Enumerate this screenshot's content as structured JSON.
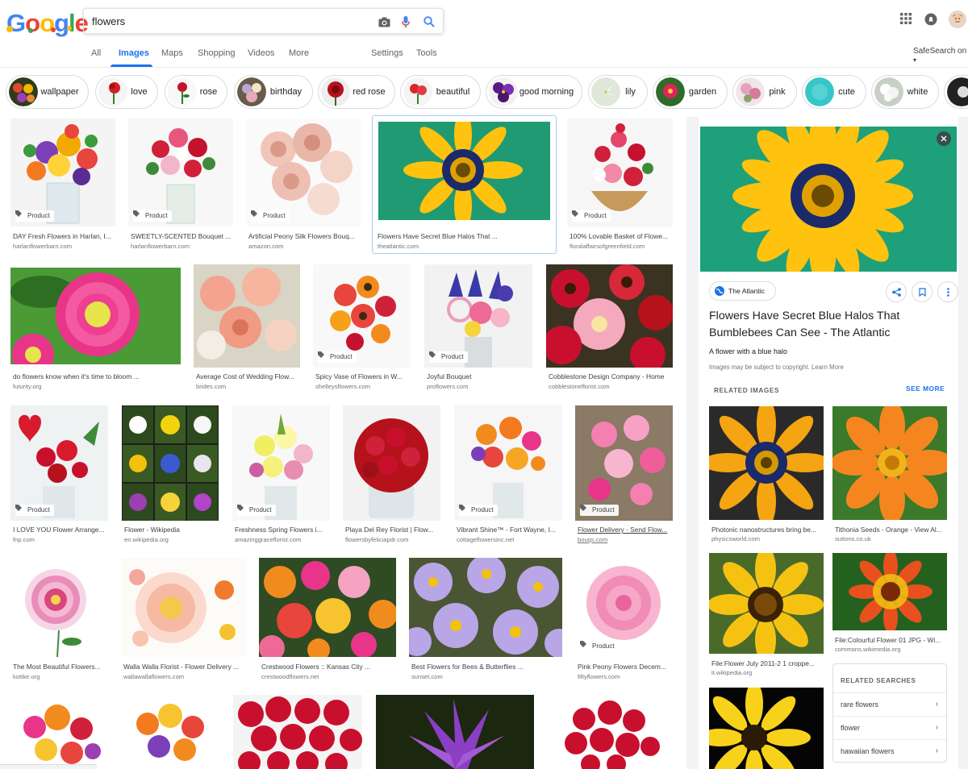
{
  "header": {
    "logo_letters": [
      "G",
      "o",
      "o",
      "g",
      "l",
      "e"
    ],
    "logo_colors": [
      "#4285f4",
      "#ea4335",
      "#fbbc05",
      "#4285f4",
      "#34a853",
      "#ea4335"
    ],
    "search_query": "flowers",
    "tabs": [
      {
        "label": "All",
        "active": false
      },
      {
        "label": "Images",
        "active": true
      },
      {
        "label": "Maps",
        "active": false
      },
      {
        "label": "Shopping",
        "active": false
      },
      {
        "label": "Videos",
        "active": false
      },
      {
        "label": "More",
        "active": false
      }
    ],
    "settings_label": "Settings",
    "tools_label": "Tools",
    "safesearch_label": "SafeSearch on",
    "accent_color": "#1a73e8"
  },
  "chips": [
    "wallpaper",
    "love",
    "rose",
    "birthday",
    "red rose",
    "beautiful",
    "good morning",
    "lily",
    "garden",
    "pink",
    "cute",
    "white"
  ],
  "product_label": "Product",
  "results": [
    {
      "title": "DAY Fresh Flowers in Harlan, I...",
      "source": "harlanflowerbarn.com"
    },
    {
      "title": "SWEETLY-SCENTED Bouquet ...",
      "source": "harlanflowerbarn.com"
    },
    {
      "title": "Artificial Peony Silk Flowers Bouq...",
      "source": "amazon.com"
    },
    {
      "title": "Flowers Have Secret Blue Halos That ...",
      "source": "theatlantic.com"
    },
    {
      "title": "100% Lovable Basket of Flowe...",
      "source": "floralaffairsofgreenfield.com"
    },
    {
      "title": "do flowers know when it's time to bloom ...",
      "source": "futurity.org"
    },
    {
      "title": "Average Cost of Wedding Flow...",
      "source": "brides.com"
    },
    {
      "title": "Spicy Vase of Flowers in W...",
      "source": "shelleysflowers.com"
    },
    {
      "title": "Joyful Bouquet",
      "source": "proflowers.com"
    },
    {
      "title": "Cobblestone Design Company - Home",
      "source": "cobblestoneflorist.com"
    },
    {
      "title": "I LOVE YOU Flower Arrange...",
      "source": "fnp.com"
    },
    {
      "title": "Flower - Wikipedia",
      "source": "en.wikipedia.org"
    },
    {
      "title": "Freshness Spring Flowers i...",
      "source": "amazinggraceflorist.com"
    },
    {
      "title": "Playa Del Rey Florist | Flow...",
      "source": "flowersbyfeliciapdr.com"
    },
    {
      "title": "Vibrant Shine™ - Fort Wayne, I...",
      "source": "cottageflowersinc.net"
    },
    {
      "title": "Flower Delivery - Send Flow...",
      "source": "bouqs.com"
    },
    {
      "title": "The Most Beautiful Flowers...",
      "source": "kottke.org"
    },
    {
      "title": "Walla Walla Florist - Flower Delivery ...",
      "source": "wallawallaflowers.com"
    },
    {
      "title": "Crestwood Flowers :: Kansas City ...",
      "source": "crestwoodflowers.net"
    },
    {
      "title": "Best Flowers for Bees & Butterflies ...",
      "source": "sunset.com"
    },
    {
      "title": "Pink Peony Flowers Decem...",
      "source": "fiftyflowers.com"
    }
  ],
  "panel": {
    "source_name": "The Atlantic",
    "title": "Flowers Have Secret Blue Halos That Bumblebees Can See - The Atlantic",
    "description": "A flower with a blue halo",
    "copyright": "Images may be subject to copyright.",
    "learn_more": "Learn More",
    "related_heading": "RELATED IMAGES",
    "see_more": "SEE MORE",
    "related": [
      {
        "title": "Photonic nanostructures bring be...",
        "source": "physicsworld.com"
      },
      {
        "title": "Tithonia Seeds - Orange - View Al...",
        "source": "suttons.co.uk"
      },
      {
        "title": "File:Flower July 2011-2 1 croppe...",
        "source": "it.wikipedia.org"
      },
      {
        "title": "File:Colourful Flower 01 JPG - Wi...",
        "source": "commons.wikimedia.org"
      }
    ],
    "related_searches_heading": "RELATED SEARCHES",
    "related_searches": [
      "rare flowers",
      "flower",
      "hawaiian flowers"
    ]
  }
}
